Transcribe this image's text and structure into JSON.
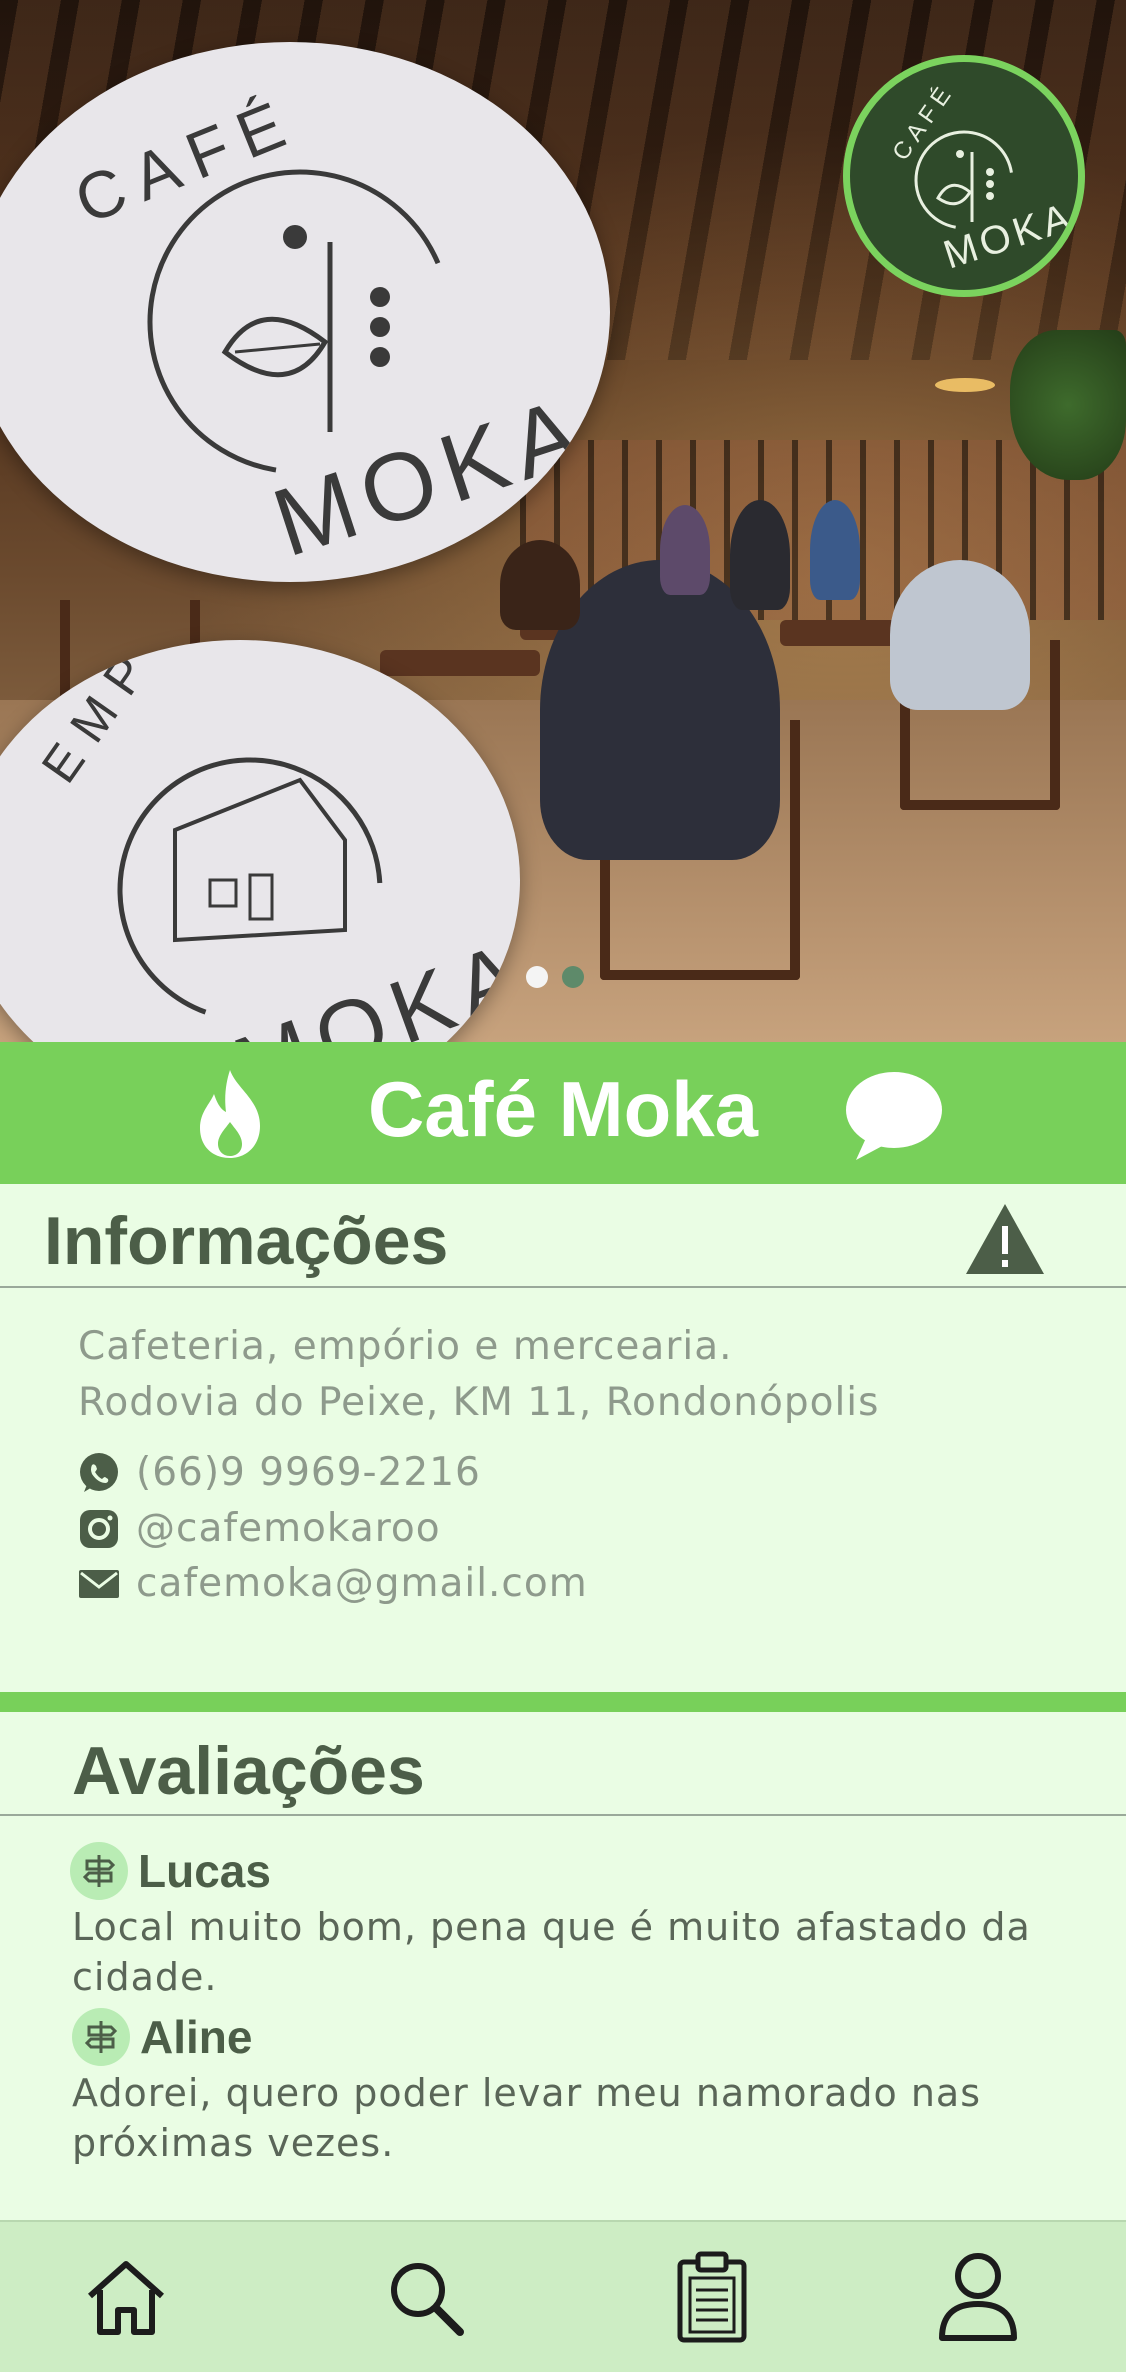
{
  "hero": {
    "sign_top_text_top": "CAFÉ",
    "sign_top_text_bottom": "MOKA",
    "sign_bottom_text_top": "EMPÓRIO",
    "sign_bottom_text_bottom": "MOKA",
    "badge_text_top": "CAFÉ",
    "badge_text_bottom": "MOKA",
    "carousel": {
      "count": 2,
      "active": 1
    }
  },
  "titlebar": {
    "title": "Café Moka",
    "left_icon": "flame-icon",
    "right_icon": "chat-bubble-icon"
  },
  "info": {
    "heading": "Informações",
    "alert_icon": "warning-icon",
    "description": "Cafeteria, empório e mercearia.",
    "address": "Rodovia do Peixe, KM 11, Rondonópolis",
    "phone": "(66)9 9969-2216",
    "instagram": "@cafemokaroo",
    "email": "cafemoka@gmail.com"
  },
  "reviews": {
    "heading": "Avaliações",
    "items": [
      {
        "name": "Lucas",
        "text": "Local muito bom, pena que é muito afastado da cidade."
      },
      {
        "name": "Aline",
        "text": "Adorei, quero poder levar meu namorado nas próximas vezes."
      }
    ]
  },
  "nav": {
    "items": [
      "home-icon",
      "search-icon",
      "clipboard-icon",
      "profile-icon"
    ]
  },
  "colors": {
    "accent": "#78d05a",
    "background": "#eafde4",
    "nav_background": "#cdedc4",
    "heading": "#4c5e48",
    "text": "#8e9a8c"
  }
}
